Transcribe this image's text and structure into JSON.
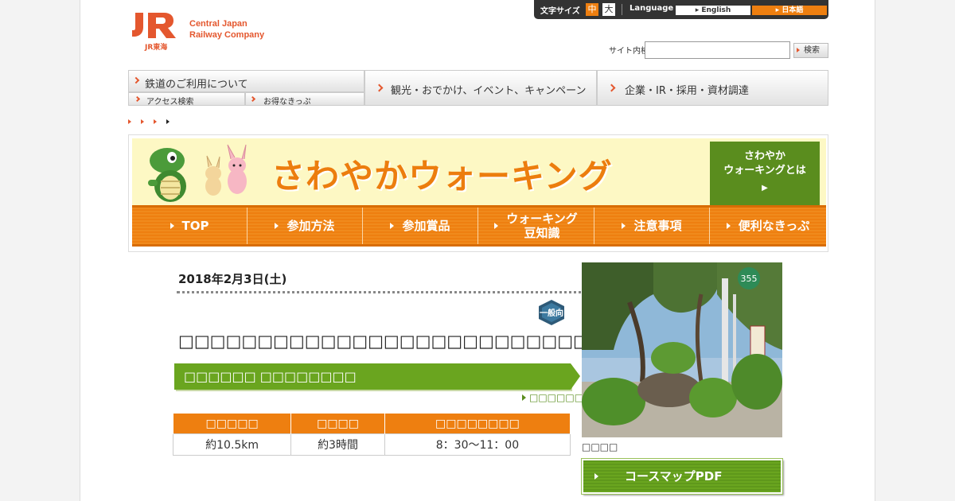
{
  "logo": {
    "mark": "JR",
    "sub": "JR東海",
    "name_line1": "Central Japan",
    "name_line2": "Railway Company"
  },
  "util": {
    "font_size_label": "文字サイズ",
    "size_medium": "中",
    "size_large": "大",
    "language_label": "Language",
    "lang_english": "English",
    "lang_japanese": "日本語"
  },
  "search": {
    "label": "サイト内検索",
    "button": "検索",
    "value": ""
  },
  "nav": {
    "railway": "鉄道のご利用について",
    "access": "アクセス検索",
    "tickets": "お得なきっぷ",
    "tourism": "観光・おでかけ、イベント、キャンペーン",
    "corporate": "企業・IR・採用・資材調達"
  },
  "banner": {
    "title": "さわやかウォーキング",
    "about_line1": "さわやか",
    "about_line2": "ウォーキングとは",
    "tabs": [
      {
        "label": "TOP"
      },
      {
        "label": "参加方法"
      },
      {
        "label": "参加賞品"
      },
      {
        "label_line1": "ウォーキング",
        "label_line2": "豆知識"
      },
      {
        "label": "注意事項"
      },
      {
        "label": "便利なきっぷ"
      }
    ]
  },
  "event": {
    "date": "2018年2月3日(土)",
    "badge": "一般向",
    "title": "□□□□□□□□□□□□□□□□□□□□□□□□□□□□□□□",
    "station": "□□□□□□ □□□□□□□□",
    "link": "□□□□□□□□",
    "table": {
      "headers": [
        "□□□□□",
        "□□□□",
        "□□□□□□□□"
      ],
      "row": [
        "約10.5km",
        "約3時間",
        "8：30～11：00"
      ]
    }
  },
  "photo": {
    "caption": "□□□□",
    "sign": "355"
  },
  "pdf_button": "コースマップPDF",
  "colors": {
    "orange": "#ee7f10",
    "green": "#6aa51f",
    "jr_orange": "#e4572e"
  }
}
